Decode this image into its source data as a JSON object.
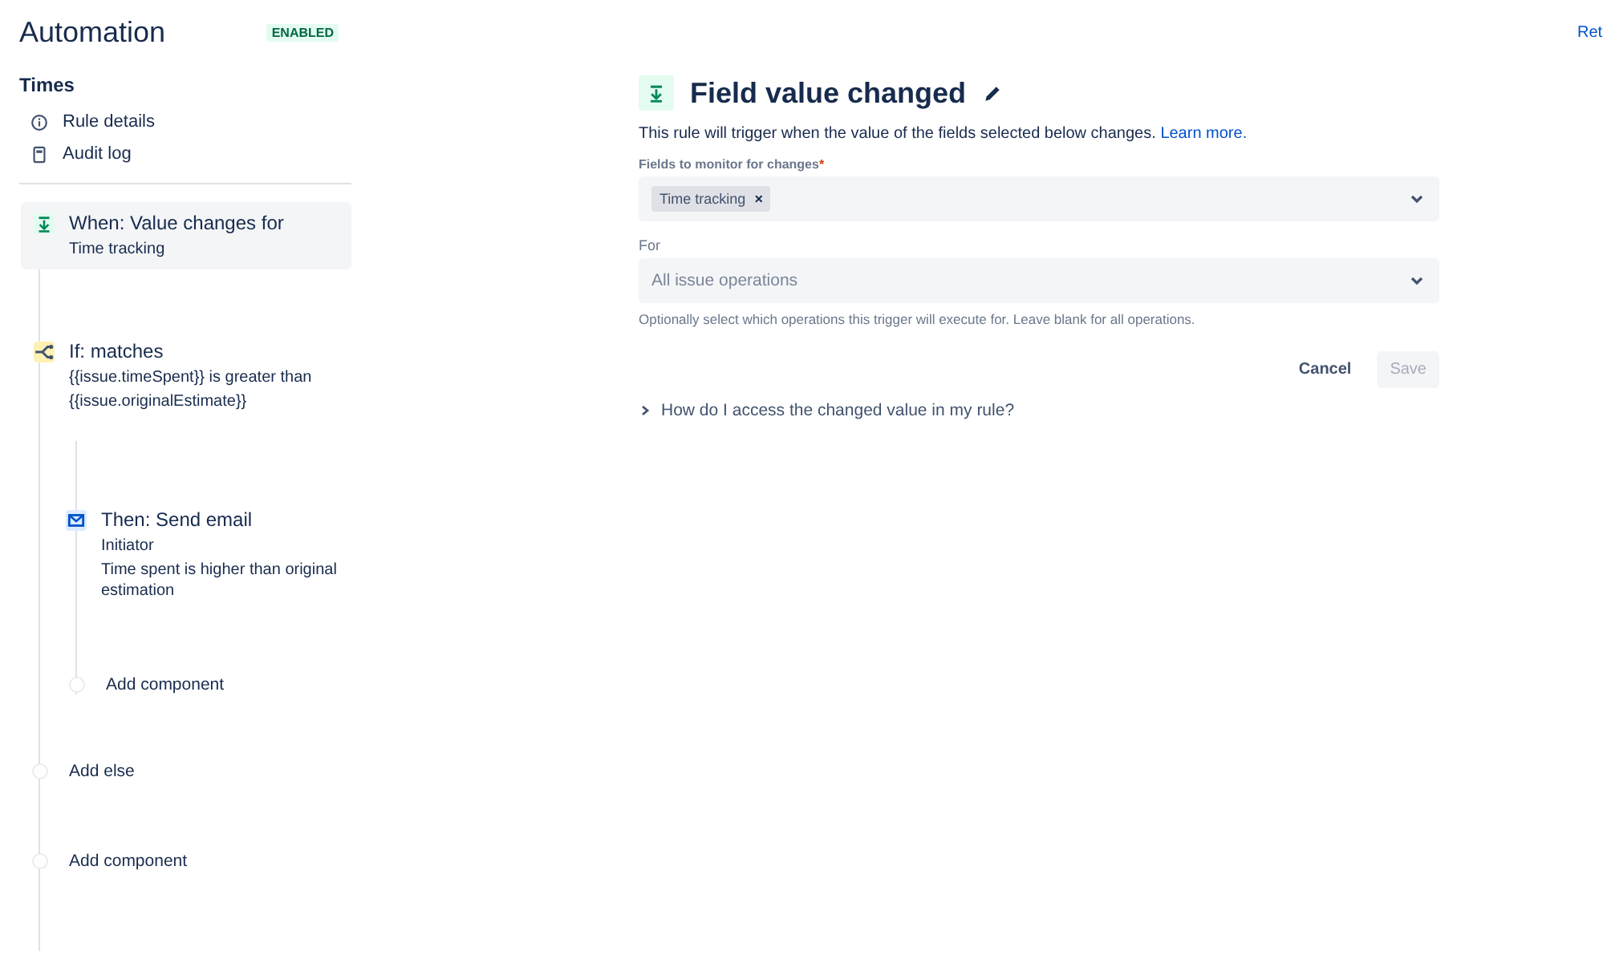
{
  "header": {
    "title": "Automation",
    "status": "ENABLED",
    "top_link": "Ret"
  },
  "sidebar": {
    "rule_name": "Times",
    "items": [
      {
        "label": "Rule details",
        "kind": "info"
      },
      {
        "label": "Audit log",
        "kind": "log"
      }
    ]
  },
  "flow": [
    {
      "kind": "trigger",
      "title": "When: Value changes for",
      "details": [
        "Time tracking"
      ],
      "selected": true
    },
    {
      "kind": "condition",
      "title": "If: matches",
      "details": [
        "{{issue.timeSpent}} is greater than",
        "{{issue.originalEstimate}}"
      ],
      "selected": false,
      "children": [
        {
          "kind": "action",
          "title": "Then: Send email",
          "details": [
            "Initiator",
            "Time spent is higher than original estimation"
          ],
          "selected": false
        },
        {
          "kind": "add",
          "title": "Add component"
        }
      ]
    },
    {
      "kind": "add",
      "title": "Add else"
    },
    {
      "kind": "add",
      "title": "Add component"
    }
  ],
  "panel": {
    "title": "Field value changed",
    "description": "This rule will trigger when the value of the fields selected below changes.",
    "learn_more": "Learn more.",
    "fields_label": "Fields to monitor for changes",
    "required_mark": "*",
    "tags": [
      {
        "label": "Time tracking",
        "remove": "×"
      }
    ],
    "for_label": "For",
    "for_placeholder": "All issue operations",
    "for_help": "Optionally select which operations this trigger will execute for. Leave blank for all operations.",
    "buttons": [
      {
        "label": "Cancel",
        "kind": "link",
        "disabled": false
      },
      {
        "label": "Save",
        "kind": "primary",
        "disabled": true
      }
    ],
    "expander": {
      "label": "How do I access the changed value in my rule?",
      "expanded": false
    }
  }
}
